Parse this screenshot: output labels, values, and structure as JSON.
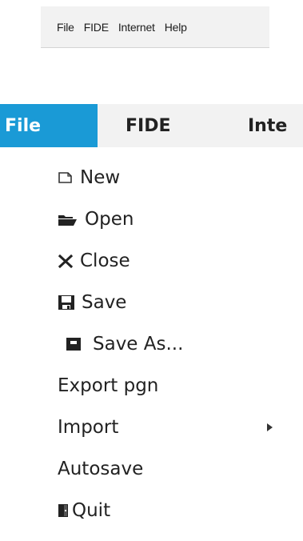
{
  "small_menubar": {
    "items": [
      "File",
      "FIDE",
      "Internet",
      "Help"
    ]
  },
  "big_menubar": {
    "items": [
      "File",
      "FIDE",
      "Inte"
    ],
    "active_color": "#1a9ad6"
  },
  "file_menu": {
    "items": [
      {
        "label": "New",
        "icon": "new-file-icon"
      },
      {
        "label": "Open",
        "icon": "open-folder-icon"
      },
      {
        "label": "Close",
        "icon": "close-icon"
      },
      {
        "label": "Save",
        "icon": "save-icon"
      },
      {
        "label": "Save As...",
        "icon": "save-as-icon"
      },
      {
        "label": "Export pgn",
        "icon": ""
      },
      {
        "label": "Import",
        "icon": "",
        "has_submenu": true
      },
      {
        "label": "Autosave",
        "icon": ""
      },
      {
        "label": "Quit",
        "icon": "quit-door-icon"
      }
    ]
  }
}
